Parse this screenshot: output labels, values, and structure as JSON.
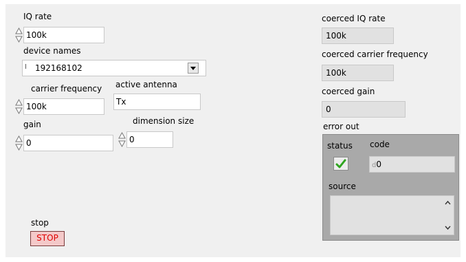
{
  "controls": {
    "iq_rate": {
      "label": "IQ rate",
      "value": "100k"
    },
    "device_names": {
      "label": "device names",
      "radix": "I",
      "value": "192168102"
    },
    "carrier_frequency": {
      "label": "carrier frequency",
      "value": "100k"
    },
    "active_antenna": {
      "label": "active antenna",
      "value": "Tx"
    },
    "gain": {
      "label": "gain",
      "value": "0"
    },
    "dimension_size": {
      "label": "dimension size",
      "value": "0"
    },
    "stop": {
      "label": "stop",
      "button_text": "STOP"
    }
  },
  "indicators": {
    "coerced_iq_rate": {
      "label": "coerced IQ rate",
      "value": "100k"
    },
    "coerced_carrier_frequency": {
      "label": "coerced carrier frequency",
      "value": "100k"
    },
    "coerced_gain": {
      "label": "coerced gain",
      "value": "0"
    }
  },
  "error_out": {
    "label": "error out",
    "status_label": "status",
    "code_label": "code",
    "code_radix": "d",
    "code_value": "0",
    "source_label": "source",
    "status_ok": true
  },
  "colors": {
    "panel_bg": "#f0f0f0",
    "stop_text": "#e00000",
    "status_check": "#2fa51f"
  }
}
